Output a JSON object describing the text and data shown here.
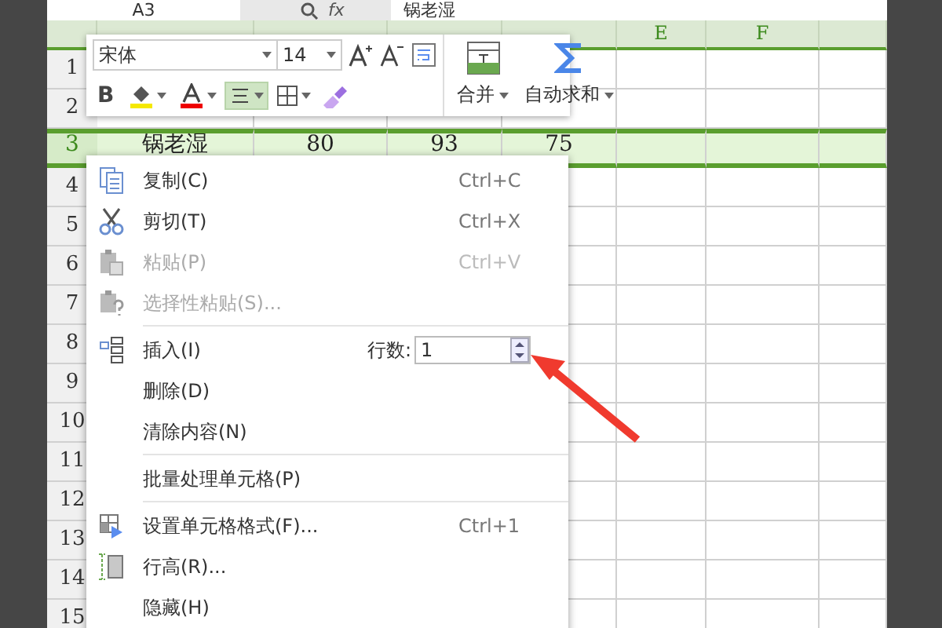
{
  "formula_bar": {
    "name_box": "A3",
    "fx": "fx",
    "value": "锅老湿"
  },
  "columns": [
    {
      "label": "E"
    },
    {
      "label": "F"
    }
  ],
  "rows": [
    {
      "number": "1",
      "selected": false,
      "cells": []
    },
    {
      "number": "2",
      "selected": false,
      "cells": []
    },
    {
      "number": "3",
      "selected": true,
      "cells": [
        "锅老湿",
        "80",
        "93",
        "75"
      ]
    },
    {
      "number": "4",
      "selected": false,
      "cells": []
    },
    {
      "number": "5",
      "selected": false,
      "cells": []
    },
    {
      "number": "6",
      "selected": false,
      "cells": []
    },
    {
      "number": "7",
      "selected": false,
      "cells": []
    },
    {
      "number": "8",
      "selected": false,
      "cells": []
    },
    {
      "number": "9",
      "selected": false,
      "cells": []
    },
    {
      "number": "10",
      "selected": false,
      "cells": []
    },
    {
      "number": "11",
      "selected": false,
      "cells": []
    },
    {
      "number": "12",
      "selected": false,
      "cells": []
    },
    {
      "number": "13",
      "selected": false,
      "cells": []
    },
    {
      "number": "14",
      "selected": false,
      "cells": []
    },
    {
      "number": "15",
      "selected": false,
      "cells": []
    }
  ],
  "mini_toolbar": {
    "font": "宋体",
    "size": "14",
    "bold": "B",
    "align_selected": true,
    "merge": "合并",
    "autosum": "自动求和"
  },
  "context_menu": [
    {
      "kind": "item",
      "label": "复制(C)",
      "shortcut": "Ctrl+C",
      "disabled": false
    },
    {
      "kind": "item",
      "label": "剪切(T)",
      "shortcut": "Ctrl+X",
      "disabled": false
    },
    {
      "kind": "item",
      "label": "粘贴(P)",
      "shortcut": "Ctrl+V",
      "disabled": true
    },
    {
      "kind": "item",
      "label": "选择性粘贴(S)...",
      "disabled": true
    },
    {
      "kind": "separator"
    },
    {
      "kind": "insert",
      "label": "插入(I)",
      "field_label": "行数:",
      "value": "1",
      "disabled": false
    },
    {
      "kind": "item",
      "label": "删除(D)",
      "disabled": false
    },
    {
      "kind": "item",
      "label": "清除内容(N)",
      "disabled": false
    },
    {
      "kind": "separator"
    },
    {
      "kind": "item",
      "label": "批量处理单元格(P)",
      "disabled": false
    },
    {
      "kind": "separator"
    },
    {
      "kind": "item",
      "label": "设置单元格格式(F)...",
      "shortcut": "Ctrl+1",
      "disabled": false
    },
    {
      "kind": "item",
      "label": "行高(R)...",
      "disabled": false
    },
    {
      "kind": "item",
      "label": "隐藏(H)",
      "disabled": false
    }
  ]
}
